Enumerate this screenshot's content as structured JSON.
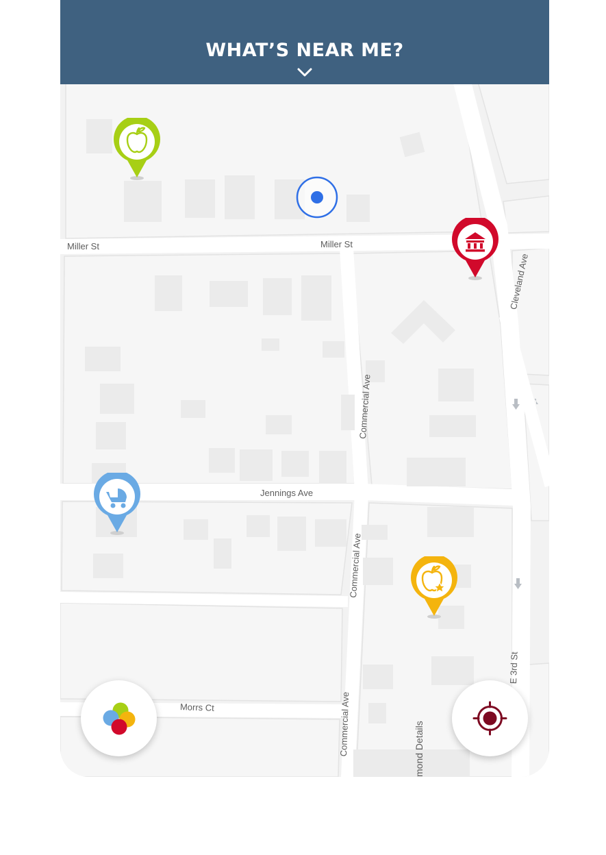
{
  "header": {
    "title": "WHAT’S NEAR ME?",
    "toggle_icon": "chevron-down-icon"
  },
  "streets": {
    "miller_west": "Miller St",
    "miller_east": "Miller St",
    "cleveland": "Cleveland Ave",
    "commercial_north": "Commercial Ave",
    "commercial_mid": "Commercial Ave",
    "commercial_south": "Commercial Ave",
    "jennings": "Jennings Ave",
    "morrs": "Morrs Ct",
    "e3rd": "E 3rd St",
    "edmond": "mond Details"
  },
  "pins": [
    {
      "kind": "grocery",
      "icon": "apple-icon",
      "color": "#a7cf15"
    },
    {
      "kind": "government",
      "icon": "bank-icon",
      "color": "#d1092b"
    },
    {
      "kind": "childcare",
      "icon": "stroller-icon",
      "color": "#6aaae4"
    },
    {
      "kind": "school",
      "icon": "apple-star-icon",
      "color": "#f4b40e"
    }
  ],
  "user_location": {
    "color": "#2f6fe6"
  },
  "buttons": {
    "filter_icon": "category-filter-icon",
    "locate_icon": "crosshair-icon"
  }
}
